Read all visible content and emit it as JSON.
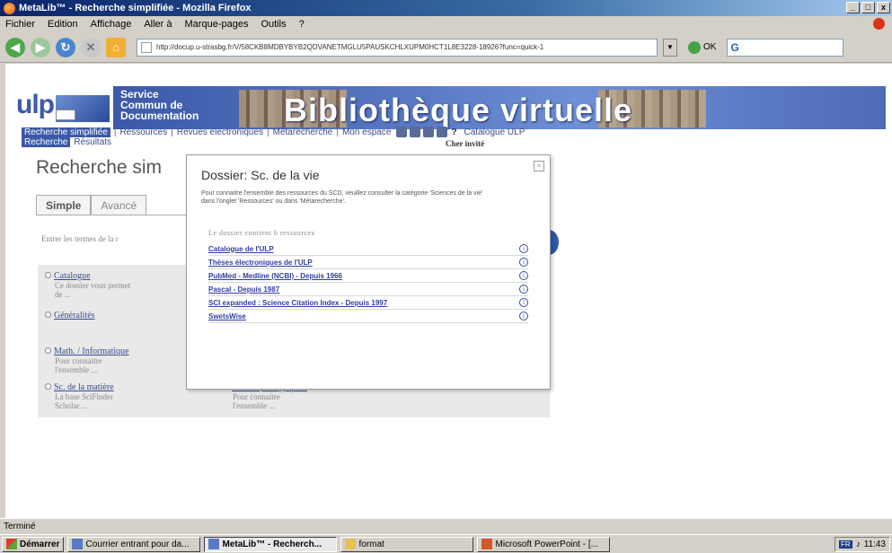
{
  "window": {
    "title": "MetaLib™ - Recherche simplifiée - Mozilla Firefox",
    "controls": [
      "_",
      "□",
      "x"
    ]
  },
  "menu": [
    "Fichier",
    "Edition",
    "Affichage",
    "Aller à",
    "Marque-pages",
    "Outils",
    "?"
  ],
  "toolbar": {
    "url": "http://docup.u-strasbg.fr/V/58CKB8MDBYBYB2QDVANETMGLU5PAUSKCHLXUPM0HCT1L8E3228-18926?func=quick-1",
    "go_label": "OK",
    "search_brand": "G"
  },
  "banner": {
    "logo": "ulp",
    "scd_lines": [
      "Service",
      "Commun de",
      "Documentation"
    ],
    "title": "Bibliothèque virtuelle"
  },
  "nav": {
    "items": [
      "Recherche simplifiée",
      "Ressources",
      "Revues électroniques",
      "Métarecherche",
      "Mon espace"
    ],
    "extra": "Catalogue ULP",
    "help": "?",
    "greeting": "Cher invité",
    "sub_active": "Recherche",
    "sub_link": "Résultats"
  },
  "page": {
    "title": "Recherche sim",
    "tab_simple": "Simple",
    "tab_advanced": "Avancé",
    "search_prompt": "Entrer les termes de la r"
  },
  "categories": {
    "left": [
      {
        "name": "Catalogue",
        "desc": [
          "Ce dossier vous permet",
          "de ..."
        ]
      },
      {
        "name": "Généralités",
        "desc": []
      },
      {
        "name": "Math. / Informatique",
        "desc": [
          "Pour connaitre",
          "l'ensemble ..."
        ]
      },
      {
        "name": "Sc. de la matière",
        "desc": [
          "La base SciFinder",
          "Scholar ..."
        ]
      }
    ],
    "right": [
      {
        "name": "Histoire, Geographie",
        "desc": [
          "Pour connaitre",
          "l'ensemble ..."
        ]
      }
    ]
  },
  "popup": {
    "title": "Dossier: Sc. de la vie",
    "intro": "Pour connaitre l'ensemble des ressources du SCD, veuillez consulter la catégorie 'Sciences de la vie' dans l'onglet 'Ressources' ou dans 'Métarecherche'.",
    "contents_label": "Le dossier contient 6 ressources",
    "close_label": "×",
    "info_glyph": "i",
    "resources": [
      "Catalogue de l'ULP",
      "Thèses électroniques de l'ULP",
      "PubMed - Medline (NCBI) - Depuis 1966",
      "Pascal - Depuis 1987",
      "SCI expanded : Science Citation Index - Depuis 1997",
      "SwetsWise"
    ]
  },
  "status": "Terminé",
  "taskbar": {
    "start": "Démarrer",
    "items": [
      {
        "label": "Courrier entrant pour da...",
        "active": false
      },
      {
        "label": "MetaLib™ - Recherch...",
        "active": true
      },
      {
        "label": "format",
        "active": false
      },
      {
        "label": "Microsoft PowerPoint - [...",
        "active": false
      }
    ],
    "lang": "FR",
    "clock": "11:43"
  }
}
